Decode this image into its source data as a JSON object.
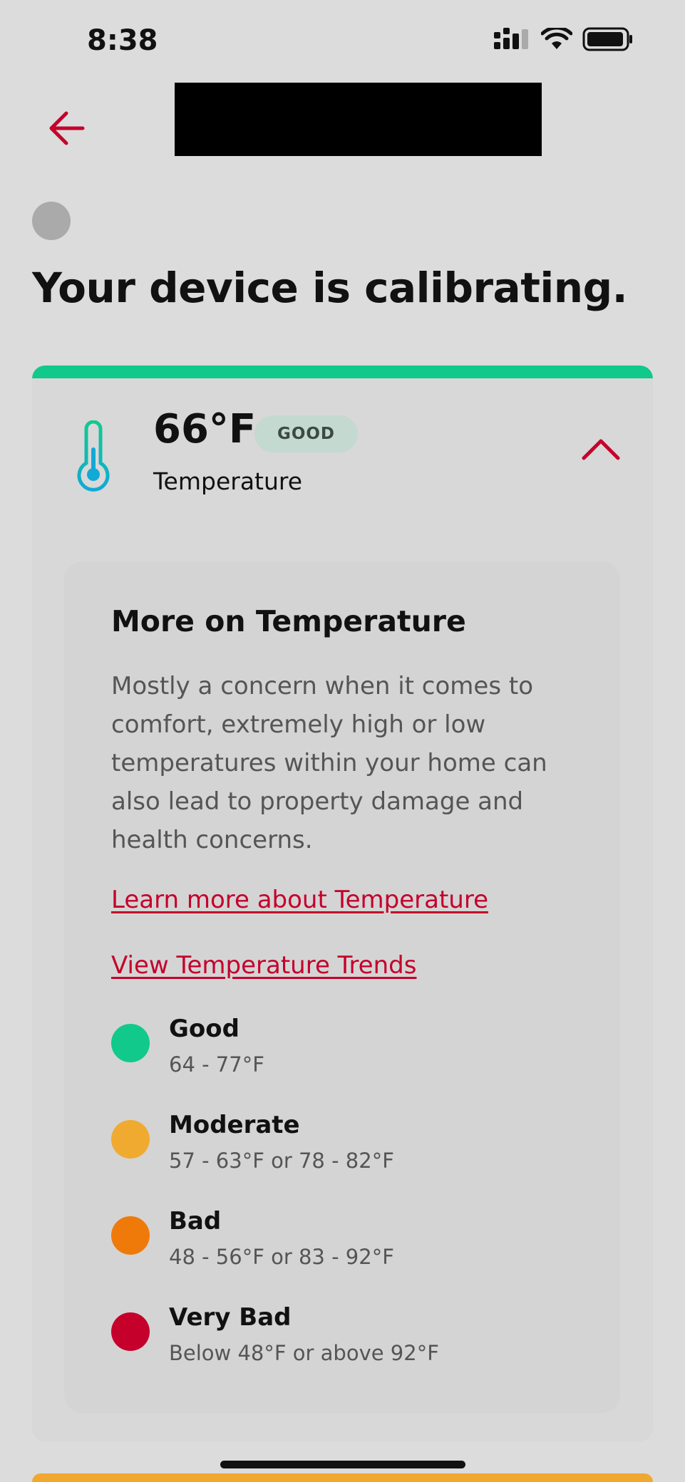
{
  "status_bar": {
    "time": "8:38",
    "icons": [
      "cellular-signal-icon",
      "wifi-icon",
      "battery-icon"
    ]
  },
  "header": {
    "back_icon": "arrow-left-icon",
    "title_redacted": true,
    "accent_color": "#c4002b"
  },
  "page": {
    "title": "Your device is calibrating."
  },
  "metric_card": {
    "status_color": "#11c98a",
    "icon": "thermometer-icon",
    "value": "66°F",
    "badge": "GOOD",
    "label": "Temperature",
    "expanded": true,
    "toggle_icon": "chevron-up-icon",
    "details": {
      "title": "More on Temperature",
      "description": "Mostly a concern when it comes to comfort, extremely high or low temperatures within your home can also lead to property damage and health concerns.",
      "learn_more_link": "Learn more about Temperature",
      "trends_link": "View Temperature Trends",
      "legend": [
        {
          "name": "Good",
          "range": "64 - 77°F",
          "color": "#11c98a"
        },
        {
          "name": "Moderate",
          "range": "57 - 63°F or 78 - 82°F",
          "color": "#f0aa30"
        },
        {
          "name": "Bad",
          "range": "48 - 56°F or 83 - 92°F",
          "color": "#ef7a0a"
        },
        {
          "name": "Very Bad",
          "range": "Below 48°F or above 92°F",
          "color": "#c4002b"
        }
      ]
    }
  }
}
